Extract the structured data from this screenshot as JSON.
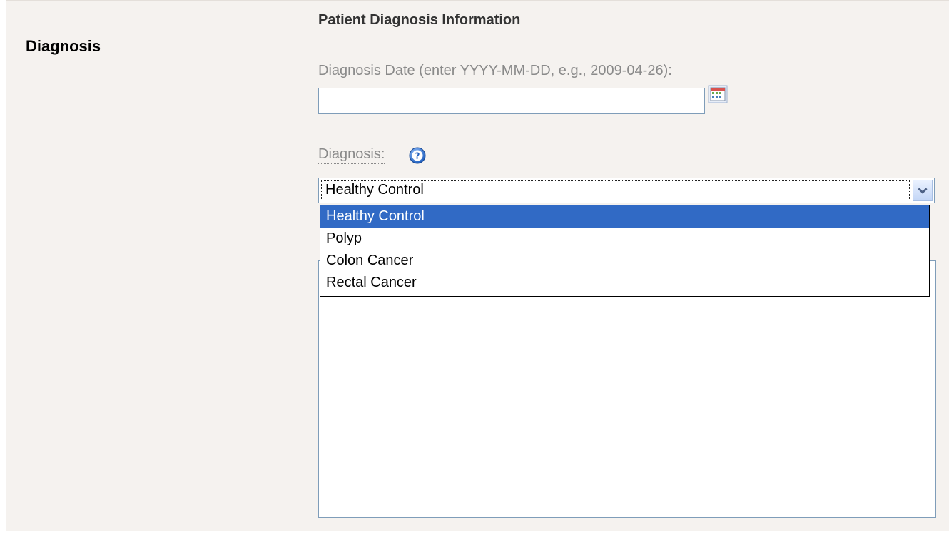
{
  "section": {
    "title": "Diagnosis"
  },
  "form": {
    "heading": "Patient Diagnosis Information",
    "date_field": {
      "label": "Diagnosis Date (enter YYYY-MM-DD, e.g., 2009-04-26):",
      "value": "",
      "calendar_icon": "calendar-icon"
    },
    "diagnosis_field": {
      "label": "Diagnosis:",
      "help_icon": "help-icon",
      "selected": "Healthy Control",
      "options": [
        "Healthy Control",
        "Polyp",
        "Colon Cancer",
        "Rectal Cancer"
      ],
      "highlighted_index": 0
    },
    "notes": {
      "value": ""
    }
  },
  "colors": {
    "panel_bg": "#f5f2ef",
    "highlight": "#316ac5",
    "input_border": "#7f9db9",
    "label": "#8a8a8a"
  }
}
